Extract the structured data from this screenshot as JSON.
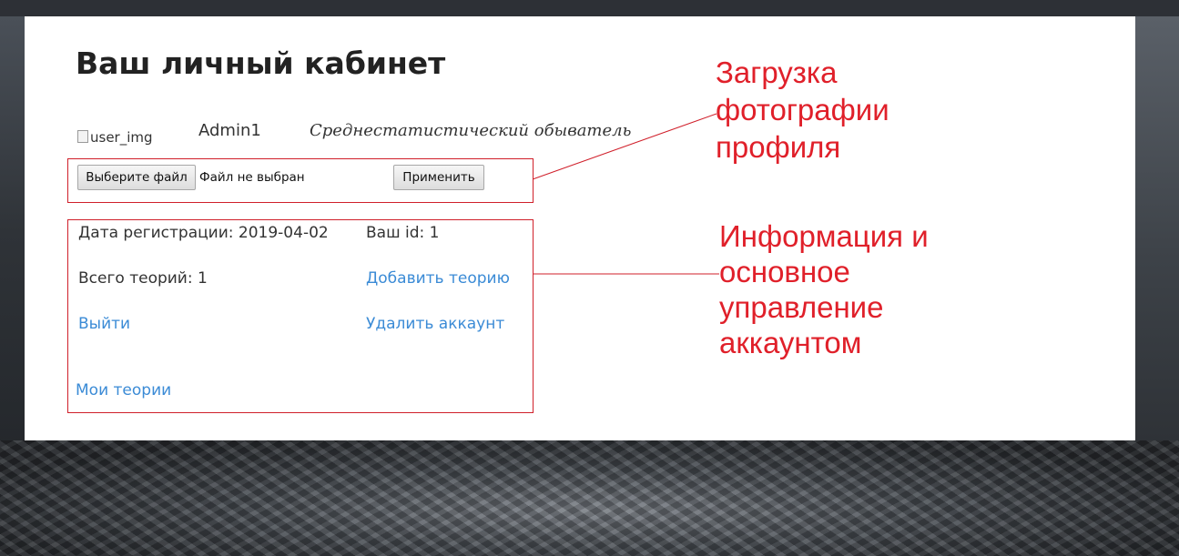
{
  "page": {
    "title": "Ваш личный кабинет"
  },
  "profile": {
    "image_alt": "user_img",
    "username": "Admin1",
    "status": "Среднестатистический обыватель"
  },
  "upload": {
    "choose_file_label": "Выберите файл",
    "file_status": "Файл не выбран",
    "apply_label": "Применить"
  },
  "info": {
    "registration_date": "Дата регистрации: 2019-04-02",
    "user_id": "Ваш id: 1",
    "theories_count": "Всего теорий: 1",
    "add_theory_link": "Добавить теорию",
    "logout_link": "Выйти",
    "delete_account_link": "Удалить аккаунт",
    "my_theories_link": "Мои теории"
  },
  "annotations": {
    "upload_note": "Загрузка\nфотографии\nпрофиля",
    "info_note": "Информация и\nосновное\nуправление\nаккаунтом"
  },
  "colors": {
    "annotation_red": "#e0202a",
    "link_blue": "#3b8bd6",
    "box_border": "#d01f2a"
  }
}
